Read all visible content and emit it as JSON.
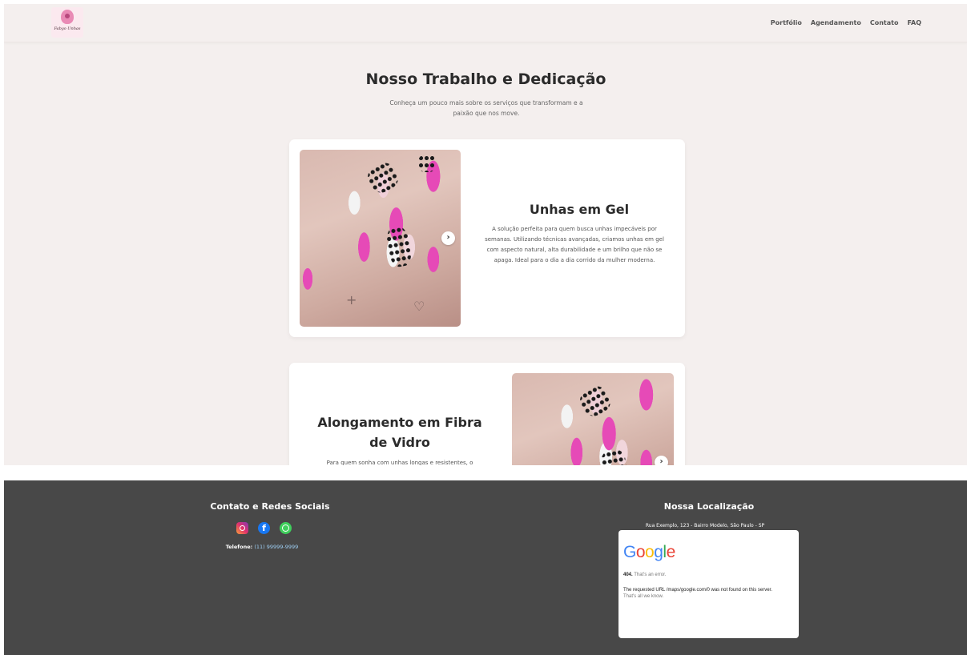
{
  "header": {
    "logo_text": "Fabyo Unhas",
    "nav": [
      "Portfólio",
      "Agendamento",
      "Contato",
      "FAQ"
    ]
  },
  "hero": {
    "title": "Nosso Trabalho e Dedicação",
    "subtitle": "Conheça um pouco mais sobre os serviços que transformam e a paixão que nos move."
  },
  "services": [
    {
      "title": "Unhas em Gel",
      "description": "A solução perfeita para quem busca unhas impecáveis por semanas. Utilizando técnicas avançadas, criamos unhas em gel com aspecto natural, alta durabilidade e um brilho que não se apaga. Ideal para o dia a dia corrido da mulher moderna.",
      "next_label": "›"
    },
    {
      "title": "Alongamento em Fibra de Vidro",
      "description": "Para quem sonha com unhas longas e resistentes, o",
      "next_label": "›"
    }
  ],
  "footer": {
    "contact_title": "Contato e Redes Sociais",
    "socials": [
      "instagram-icon",
      "facebook-icon",
      "whatsapp-icon"
    ],
    "phone_label": "Telefone:",
    "phone_value": "(11) 99999-9999",
    "location_title": "Nossa Localização",
    "address": "Rua Exemplo, 123 - Bairro Modelo, São Paulo - SP",
    "map_error": {
      "brand": "Google",
      "code": "404.",
      "code_text": "That's an error.",
      "message": "The requested URL /maps/google.com/0 was not found on this server.",
      "footnote": "That's all we know."
    }
  },
  "colors": {
    "page_bg": "#f4efee",
    "footer_bg": "#484848",
    "accent_pink": "#e64ab7",
    "link_blue": "#9fd0f5"
  }
}
